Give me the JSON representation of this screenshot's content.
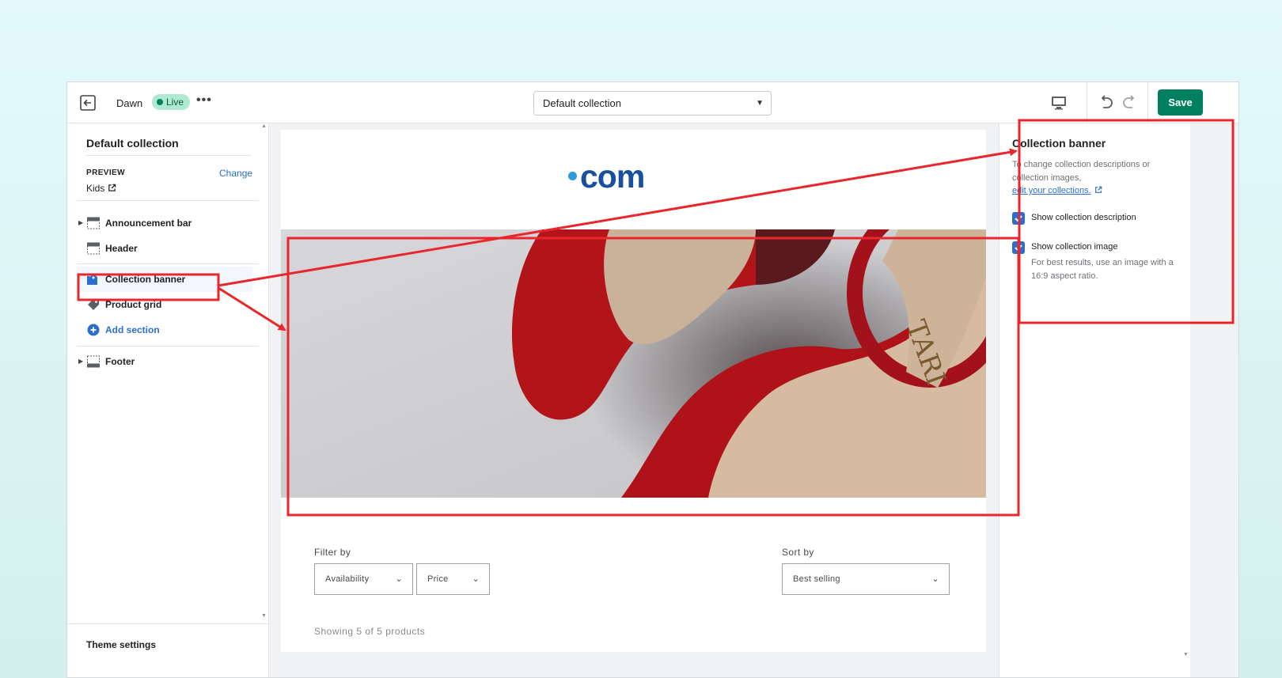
{
  "topbar": {
    "theme_name": "Dawn",
    "status_badge": "Live",
    "more_label": "•••",
    "template_select": "Default collection",
    "save_label": "Save"
  },
  "sidebar": {
    "title": "Default collection",
    "preview_label": "PREVIEW",
    "change_label": "Change",
    "preview_value": "Kids",
    "items": [
      {
        "label": "Announcement bar",
        "icon": "layout-section-icon"
      },
      {
        "label": "Header",
        "icon": "layout-header-icon"
      },
      {
        "label": "Collection banner",
        "icon": "collection-banner-icon"
      },
      {
        "label": "Product grid",
        "icon": "tag-icon"
      },
      {
        "label": "Add section",
        "icon": "plus-circle-icon"
      },
      {
        "label": "Footer",
        "icon": "layout-footer-icon"
      }
    ],
    "theme_settings_label": "Theme settings"
  },
  "preview": {
    "logo_text": "com",
    "filter_label": "Filter by",
    "filter_availability": "Availability",
    "filter_price": "Price",
    "sort_label": "Sort by",
    "sort_value": "Best selling",
    "product_count": "Showing 5 of 5 products"
  },
  "right_panel": {
    "title": "Collection banner",
    "description": "To change collection descriptions or collection images,",
    "link_text": "edit your collections.",
    "option_description": "Show collection description",
    "option_image": "Show collection image",
    "image_help": "For best results, use an image with a 16:9 aspect ratio."
  },
  "colors": {
    "save_button": "#008060",
    "live_badge": "#aee9d1",
    "checkbox": "#2c6ecb",
    "annotation": "#e8262c",
    "logo": "#1a4fa0"
  }
}
